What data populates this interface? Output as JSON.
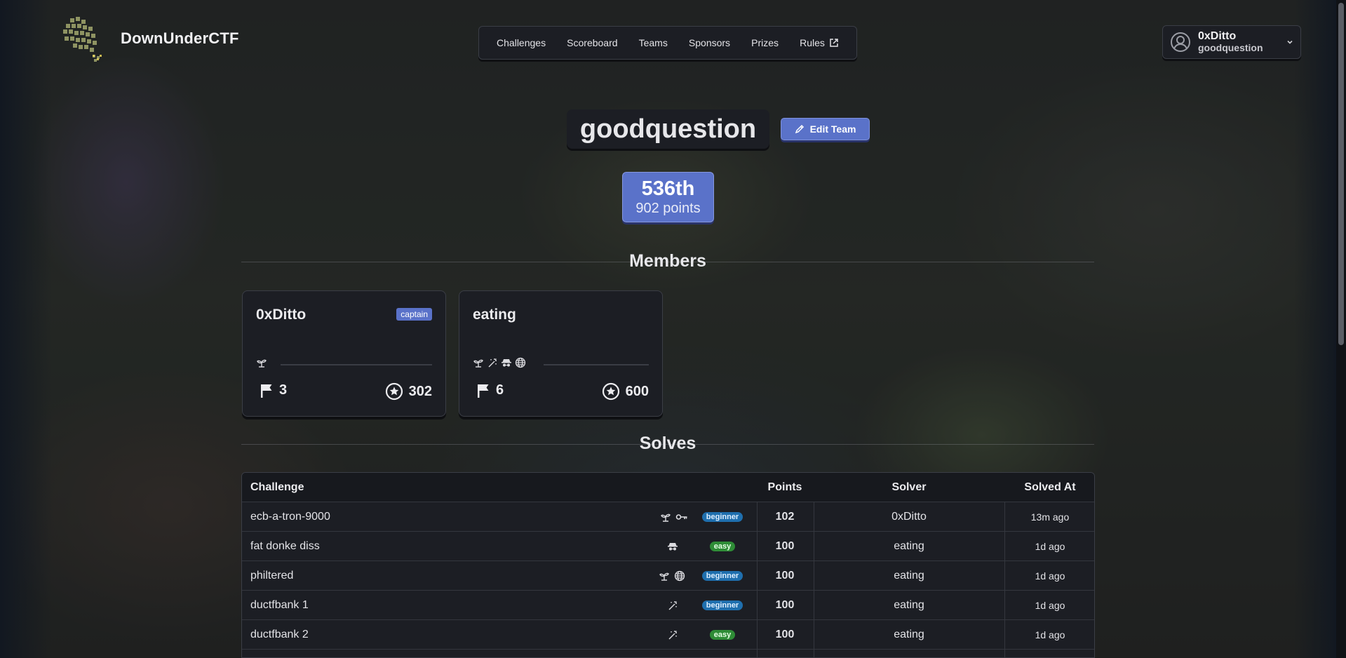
{
  "brand": {
    "name": "DownUnderCTF"
  },
  "nav": {
    "items": [
      {
        "label": "Challenges"
      },
      {
        "label": "Scoreboard"
      },
      {
        "label": "Teams"
      },
      {
        "label": "Sponsors"
      },
      {
        "label": "Prizes"
      },
      {
        "label": "Rules",
        "icon": "external-link-icon"
      }
    ]
  },
  "user": {
    "name": "0xDitto",
    "team": "goodquestion",
    "icon": "user-avatar-icon"
  },
  "team": {
    "name": "goodquestion",
    "edit_label": "Edit Team",
    "rank": "536th",
    "points": "902 points"
  },
  "members_section": {
    "title": "Members"
  },
  "members": [
    {
      "name": "0xDitto",
      "badge": "captain",
      "icons": [
        "beginner-sprout-icon"
      ],
      "solves": "3",
      "score": "302"
    },
    {
      "name": "eating",
      "badge": "",
      "icons": [
        "beginner-sprout-icon",
        "misc-wand-icon",
        "osint-spy-icon",
        "web-globe-icon"
      ],
      "solves": "6",
      "score": "600"
    }
  ],
  "solves_section": {
    "title": "Solves"
  },
  "solves_table": {
    "headers": {
      "challenge": "Challenge",
      "points": "Points",
      "solver": "Solver",
      "solved_at": "Solved At"
    },
    "rows": [
      {
        "challenge": "ecb-a-tron-9000",
        "icons": [
          "beginner-sprout-icon",
          "crypto-key-icon"
        ],
        "difficulty": "beginner",
        "points": "102",
        "solver": "0xDitto",
        "solved_at": "13m ago"
      },
      {
        "challenge": "fat donke diss",
        "icons": [
          "osint-spy-icon"
        ],
        "difficulty": "easy",
        "points": "100",
        "solver": "eating",
        "solved_at": "1d ago"
      },
      {
        "challenge": "philtered",
        "icons": [
          "beginner-sprout-icon",
          "web-globe-icon"
        ],
        "difficulty": "beginner",
        "points": "100",
        "solver": "eating",
        "solved_at": "1d ago"
      },
      {
        "challenge": "ductfbank 1",
        "icons": [
          "misc-wand-icon"
        ],
        "difficulty": "beginner",
        "points": "100",
        "solver": "eating",
        "solved_at": "1d ago"
      },
      {
        "challenge": "ductfbank 2",
        "icons": [
          "misc-wand-icon"
        ],
        "difficulty": "easy",
        "points": "100",
        "solver": "eating",
        "solved_at": "1d ago"
      }
    ]
  },
  "colors": {
    "accent": "#5a72c9",
    "beginner": "#1f6fae",
    "easy": "#2e8c36",
    "panel": "#1c1e24"
  }
}
